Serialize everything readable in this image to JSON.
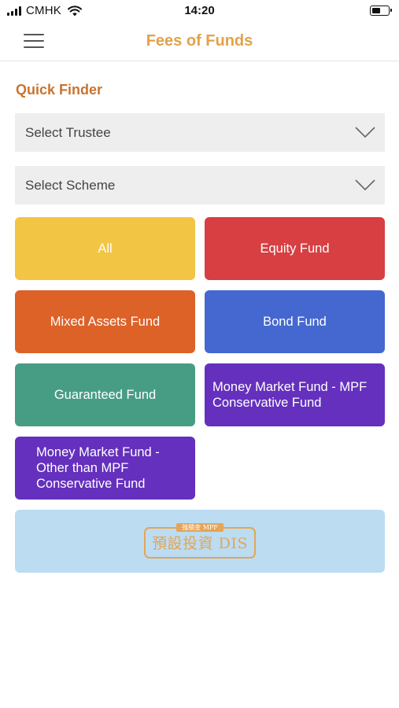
{
  "status_bar": {
    "carrier": "CMHK",
    "time": "14:20",
    "icons": [
      "signal-icon",
      "wifi-icon",
      "battery-icon"
    ]
  },
  "nav": {
    "menu_icon": "hamburger-menu-icon",
    "title": "Fees of Funds"
  },
  "quick_finder": {
    "title": "Quick Finder",
    "trustee_select": {
      "value": "Select Trustee",
      "icon": "chevron-down-icon"
    },
    "scheme_select": {
      "value": "Select Scheme",
      "icon": "chevron-down-icon"
    }
  },
  "fund_types": [
    {
      "label": "All",
      "color": "#f2c544"
    },
    {
      "label": "Equity Fund",
      "color": "#d73f42"
    },
    {
      "label": "Mixed Assets Fund",
      "color": "#dd6228"
    },
    {
      "label": "Bond Fund",
      "color": "#4468cf"
    },
    {
      "label": "Guaranteed Fund",
      "color": "#479d84"
    },
    {
      "label": "Money Market Fund - MPF Conservative Fund",
      "color": "#6430bd"
    },
    {
      "label": "Money Market Fund - Other than MPF Conservative Fund",
      "color": "#6430bd"
    }
  ],
  "dis_banner": {
    "top_text": "強積金 MPF",
    "main_text": "預設投資 DIS",
    "color": "#e4a556",
    "background": "#bcdcf2"
  },
  "colors": {
    "nav_title": "#e2a24a",
    "section_title": "#c8742e"
  }
}
